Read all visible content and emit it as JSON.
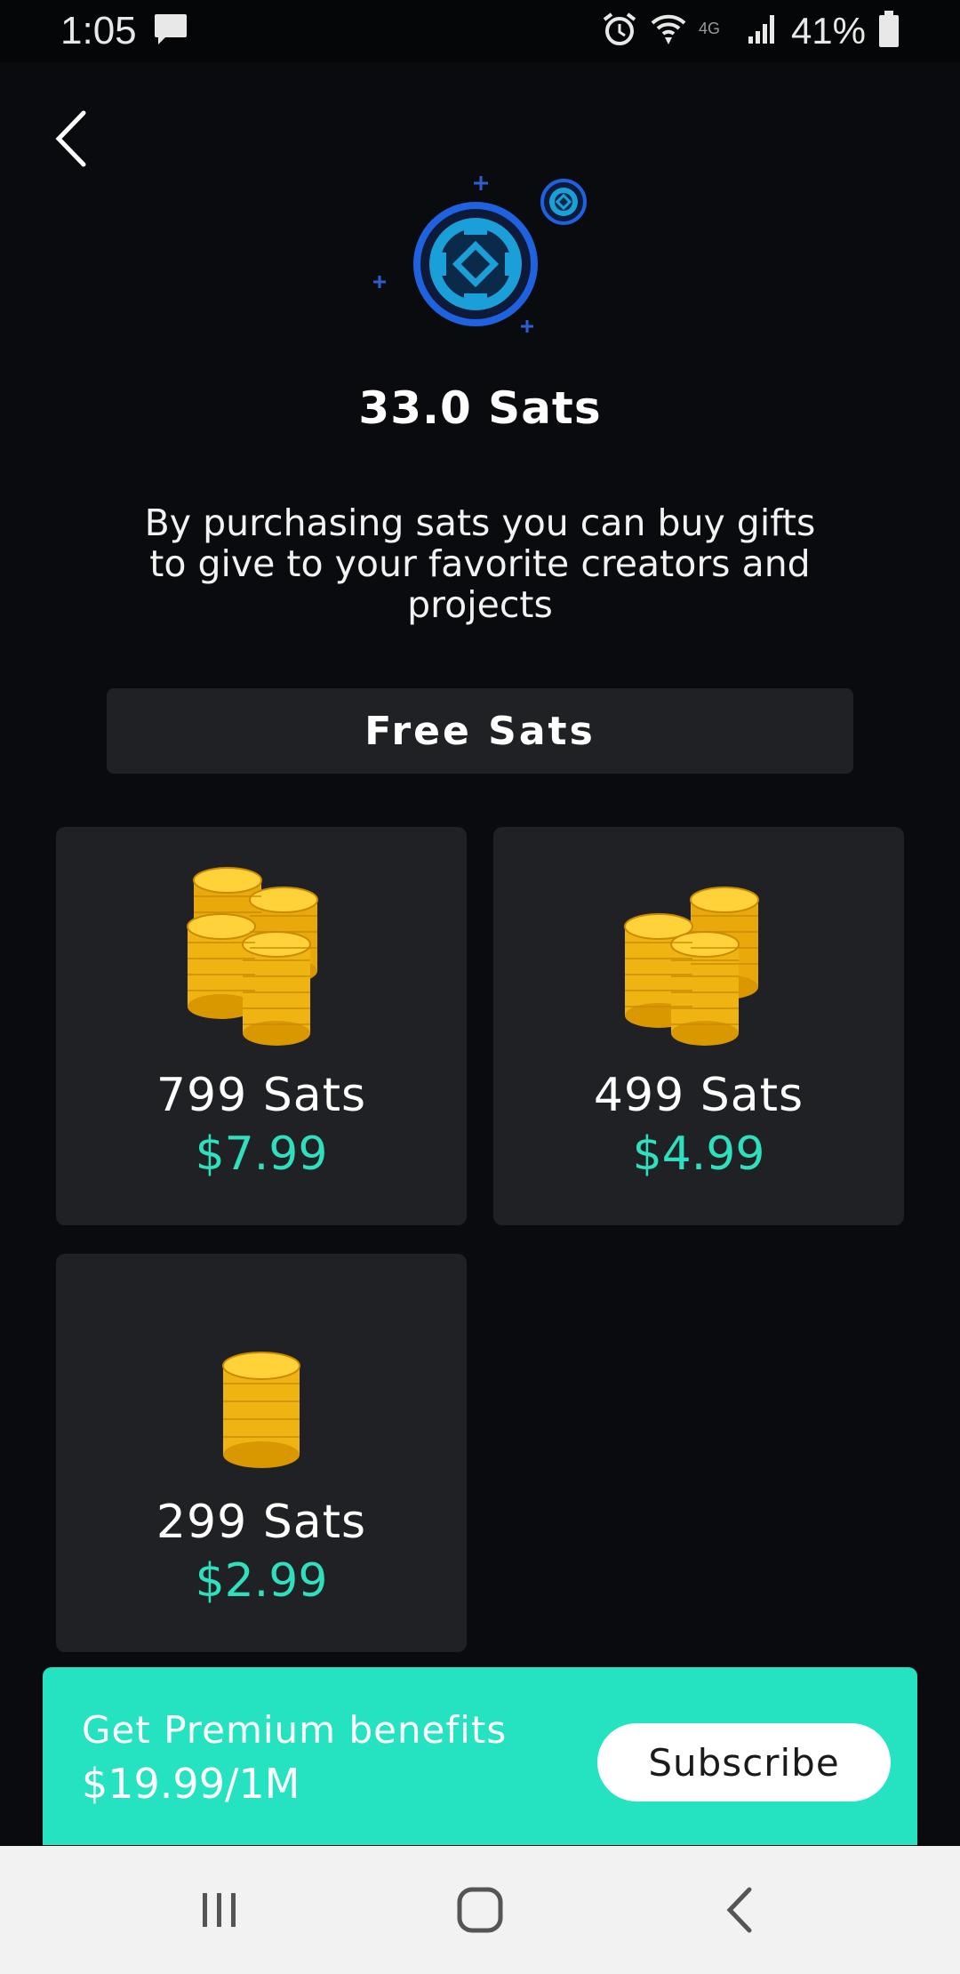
{
  "status_bar": {
    "time": "1:05",
    "battery": "41%",
    "icons": [
      "chat-icon",
      "alarm-icon",
      "wifi-icon",
      "4g-icon",
      "signal-icon",
      "battery-icon"
    ]
  },
  "header": {
    "back_icon": "back-chevron-icon"
  },
  "balance": {
    "text": "33.0 Sats"
  },
  "description": "By purchasing sats you can buy gifts to give to your favorite creators and projects",
  "free_sats_label": "Free Sats",
  "packages": [
    {
      "amount": "799 Sats",
      "price": "$7.99",
      "icon": "coin-stacks-large-icon"
    },
    {
      "amount": "499 Sats",
      "price": "$4.99",
      "icon": "coin-stacks-medium-icon"
    },
    {
      "amount": "299 Sats",
      "price": "$2.99",
      "icon": "coin-stack-small-icon"
    }
  ],
  "premium": {
    "title": "Get Premium benefits",
    "price": "$19.99/1M",
    "button_label": "Subscribe"
  },
  "nav_bar": {
    "icons": [
      "recent-apps-icon",
      "home-icon",
      "back-icon"
    ]
  },
  "colors": {
    "background": "#0a0b0f",
    "card": "#202125",
    "accent": "#2ee0bd",
    "banner": "#25e3c0"
  }
}
